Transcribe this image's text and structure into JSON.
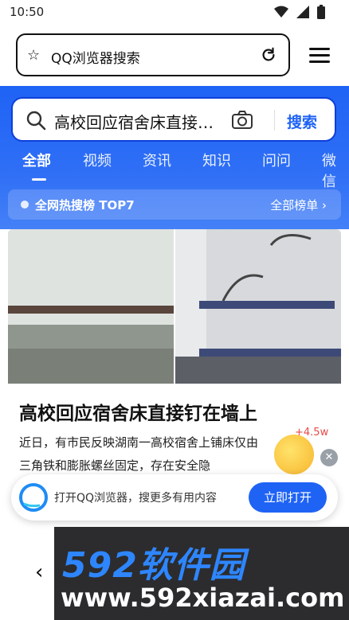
{
  "status_bar": {
    "time": "10:50"
  },
  "address_bar": {
    "text": "QQ浏览器搜索"
  },
  "search": {
    "query": "高校回应宿舍床直接…",
    "button": "搜索"
  },
  "tabs": [
    {
      "label": "全部"
    },
    {
      "label": "视频"
    },
    {
      "label": "资讯"
    },
    {
      "label": "知识"
    },
    {
      "label": "问问"
    },
    {
      "label": "微信"
    }
  ],
  "hot": {
    "title": "全网热搜榜 TOP7",
    "all_label": "全部榜单 ›"
  },
  "news": {
    "title": "高校回应宿舍床直接钉在墙上",
    "body": "近日，有市民反映湖南一高校宿舍上铺床仅由三角铁和膨胀螺丝固定，存在安全隐"
  },
  "badge": {
    "plus": "+4.5w"
  },
  "open_banner": {
    "text": "打开QQ浏览器，搜更多有用内容",
    "button": "立即打开"
  },
  "watermark": {
    "logo": "592软件园",
    "url": "www.592xiazai.com"
  },
  "colors": {
    "accent": "#1f63f5"
  }
}
